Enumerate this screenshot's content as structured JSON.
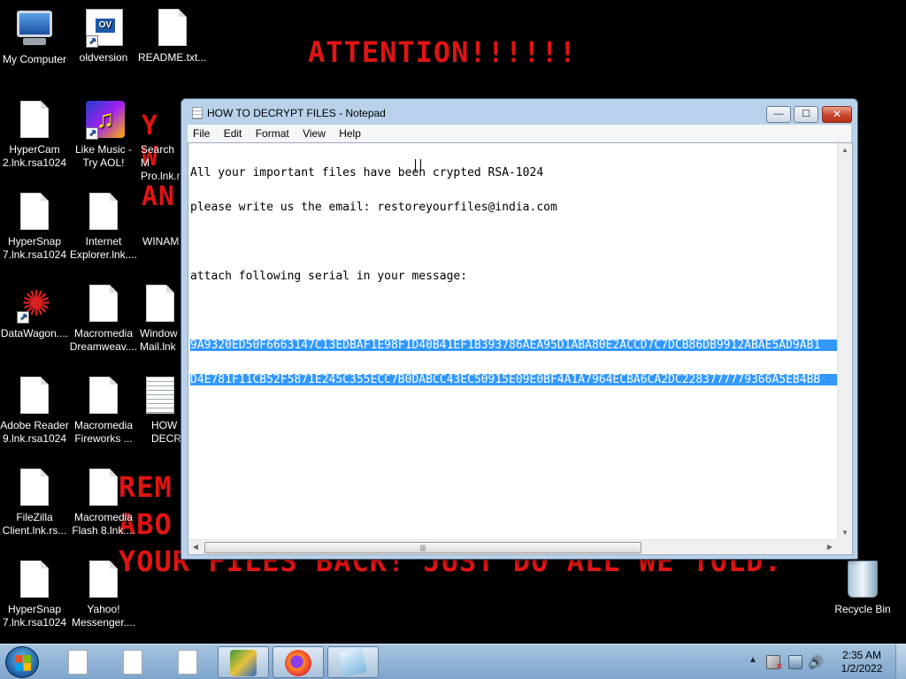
{
  "wallpaper": {
    "attention": "ATTENTION!!!!!!",
    "fragments": [
      "Y",
      "W",
      "AN"
    ],
    "lines": [
      "REM",
      "ABO",
      "YOUR FILES BACK! JUST DO ALL WE TOLD."
    ]
  },
  "desktop_icons": [
    {
      "label": "My Computer",
      "icon": "computer-icon"
    },
    {
      "label": "oldversion",
      "icon": "ov-shortcut-icon",
      "glyph": "OV"
    },
    {
      "label": "README.txt....",
      "icon": "file-icon"
    },
    {
      "label": "HyperCam 2.lnk.rsa1024",
      "icon": "file-icon"
    },
    {
      "label": "Like Music - Try AOL!",
      "icon": "music-notes-icon",
      "glyph": "♫"
    },
    {
      "label": "Search M Pro.lnk.r",
      "icon": "file-icon"
    },
    {
      "label": "HyperSnap 7.lnk.rsa1024",
      "icon": "file-icon"
    },
    {
      "label": "Internet Explorer.lnk....",
      "icon": "file-icon"
    },
    {
      "label": "WINAM",
      "icon": "file-icon"
    },
    {
      "label": "DataWagon....",
      "icon": "star-shortcut-icon",
      "glyph": "✺"
    },
    {
      "label": "Macromedia Dreamweav....",
      "icon": "file-icon"
    },
    {
      "label": "Window Mail.lnk",
      "icon": "file-icon"
    },
    {
      "label": "Adobe Reader 9.lnk.rsa1024",
      "icon": "file-icon"
    },
    {
      "label": "Macromedia Fireworks ...",
      "icon": "file-icon"
    },
    {
      "label": "HOW DECR",
      "icon": "text-file-icon"
    },
    {
      "label": "FileZilla Client.lnk.rs...",
      "icon": "file-icon"
    },
    {
      "label": "Macromedia Flash 8.lnk....",
      "icon": "file-icon"
    },
    {
      "label": "HyperSnap 7.lnk.rsa1024",
      "icon": "file-icon"
    },
    {
      "label": "Yahoo! Messenger....",
      "icon": "file-icon"
    },
    {
      "label": "Recycle Bin",
      "icon": "recycle-bin-icon"
    }
  ],
  "notepad": {
    "title": "HOW TO DECRYPT FILES - Notepad",
    "controls": {
      "minimize": "—",
      "maximize": "☐",
      "close": "✕"
    },
    "menu": [
      "File",
      "Edit",
      "Format",
      "View",
      "Help"
    ],
    "lines": [
      "All your important files have been crypted RSA-1024",
      "please write us the email: restoreyourfiles@india.com",
      "",
      "attach following serial in your message:",
      "",
      "9A9320ED50F6663147C13EDBAF1E98F1D40B41EF1B393786AEA95D1ABA80E2ACCD7C7DCB86DB9912ABAE5AD9AB1",
      "D4E781F11CB52F5871E245C355ECC7B0DABCC43EC50915E09E0BF4A1A7964ECBA6CA2DC2283777779366A5EB4BB"
    ],
    "selected_lines": [
      5,
      6
    ],
    "scroll_arrows": {
      "up": "▲",
      "down": "▼",
      "left": "◀",
      "right": "▶"
    },
    "thumb_grip": "|||"
  },
  "taskbar": {
    "clock_time": "2:35 AM",
    "clock_date": "1/2/2022",
    "tray_expand": "▲",
    "volume_glyph": "🔊"
  }
}
